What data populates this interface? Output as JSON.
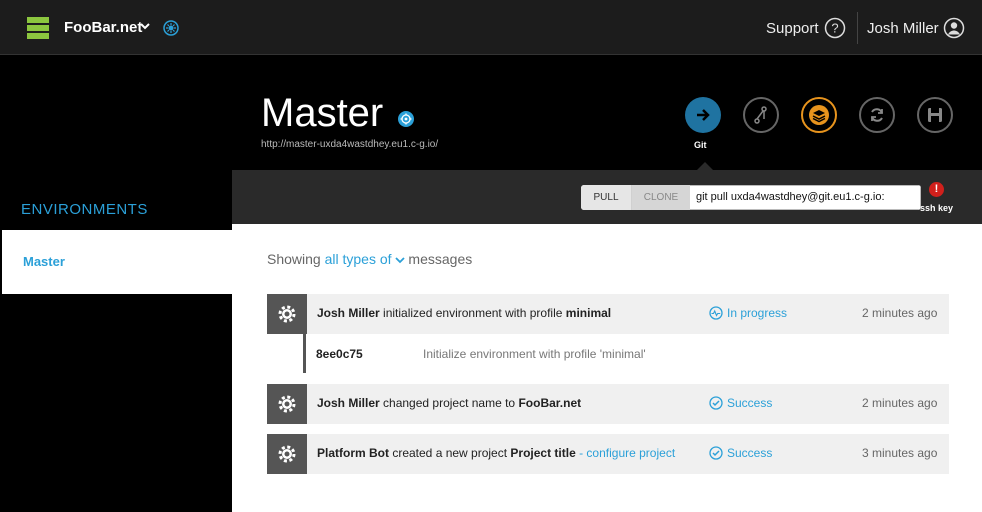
{
  "topbar": {
    "project_name": "FooBar.net",
    "support_label": "Support",
    "user_name": "Josh Miller"
  },
  "sidebar": {
    "section_title": "ENVIRONMENTS",
    "items": [
      {
        "label": "Master",
        "active": true
      }
    ]
  },
  "environment": {
    "title": "Master",
    "url": "http://master-uxda4wastdhey.eu1.c-g.io/",
    "actions": [
      {
        "name": "git",
        "icon": "arrow-right-icon",
        "label": "Git",
        "active": true
      },
      {
        "name": "branch",
        "icon": "branch-icon"
      },
      {
        "name": "layers",
        "icon": "layers-icon",
        "accent": "#e8941d"
      },
      {
        "name": "sync",
        "icon": "sync-icon"
      },
      {
        "name": "save",
        "icon": "save-icon"
      }
    ]
  },
  "gitbar": {
    "tab_pull": "PULL",
    "tab_clone": "CLONE",
    "command": "git pull uxda4wastdhey@git.eu1.c-g.io:",
    "ssh_alert": "!",
    "ssh_label": "ssh key"
  },
  "activity": {
    "showing_prefix": "Showing",
    "filter_label": "all types of",
    "showing_suffix": "messages",
    "rows": [
      {
        "actor": "Josh Miller",
        "action": " initialized environment with profile ",
        "object": "minimal",
        "status": "In progress",
        "status_icon": "pulse-icon",
        "time": "2 minutes ago"
      },
      {
        "actor": "Josh Miller",
        "action": " changed project name to ",
        "object": "FooBar.net",
        "status": "Success",
        "status_icon": "check-circle-icon",
        "time": "2 minutes ago"
      },
      {
        "actor": "Platform Bot",
        "action": " created a new project ",
        "object": "Project title",
        "link": " - configure project",
        "status": "Success",
        "status_icon": "check-circle-icon",
        "time": "3 minutes ago"
      }
    ],
    "commit": {
      "hash": "8ee0c75",
      "message": "Initialize environment with profile 'minimal'"
    }
  },
  "colors": {
    "accent_blue": "#2ba0d8",
    "logo_green": "#8cc63f",
    "git_blue": "#1f73a1",
    "alert_red": "#d0201c",
    "layers_orange": "#e8941d"
  }
}
